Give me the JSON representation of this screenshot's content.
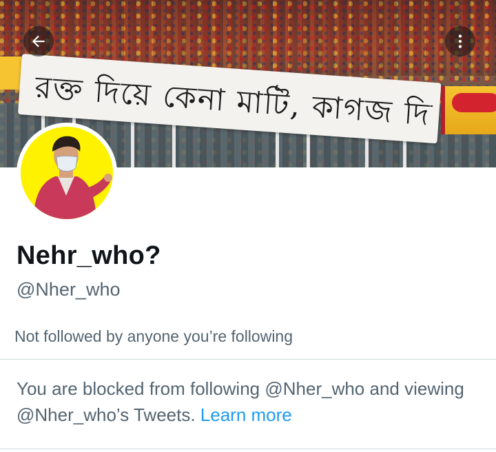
{
  "header": {
    "banner_text": "রক্ত দিয়ে কেনা মাটি, কাগজ দিয়ে নয়",
    "back_icon": "arrow-left-icon",
    "more_icon": "more-vertical-icon"
  },
  "profile": {
    "display_name": "Nehr_who?",
    "handle": "@Nher_who",
    "followers_note": "Not followed by anyone you’re following"
  },
  "blocked": {
    "message": "You are blocked from following @Nher_who and viewing @Nher_who’s Tweets.",
    "link_label": "Learn more"
  },
  "colors": {
    "link": "#1d9bf0",
    "secondary_text": "#536471",
    "primary_text": "#0f1419",
    "avatar_background": "#fff200"
  }
}
